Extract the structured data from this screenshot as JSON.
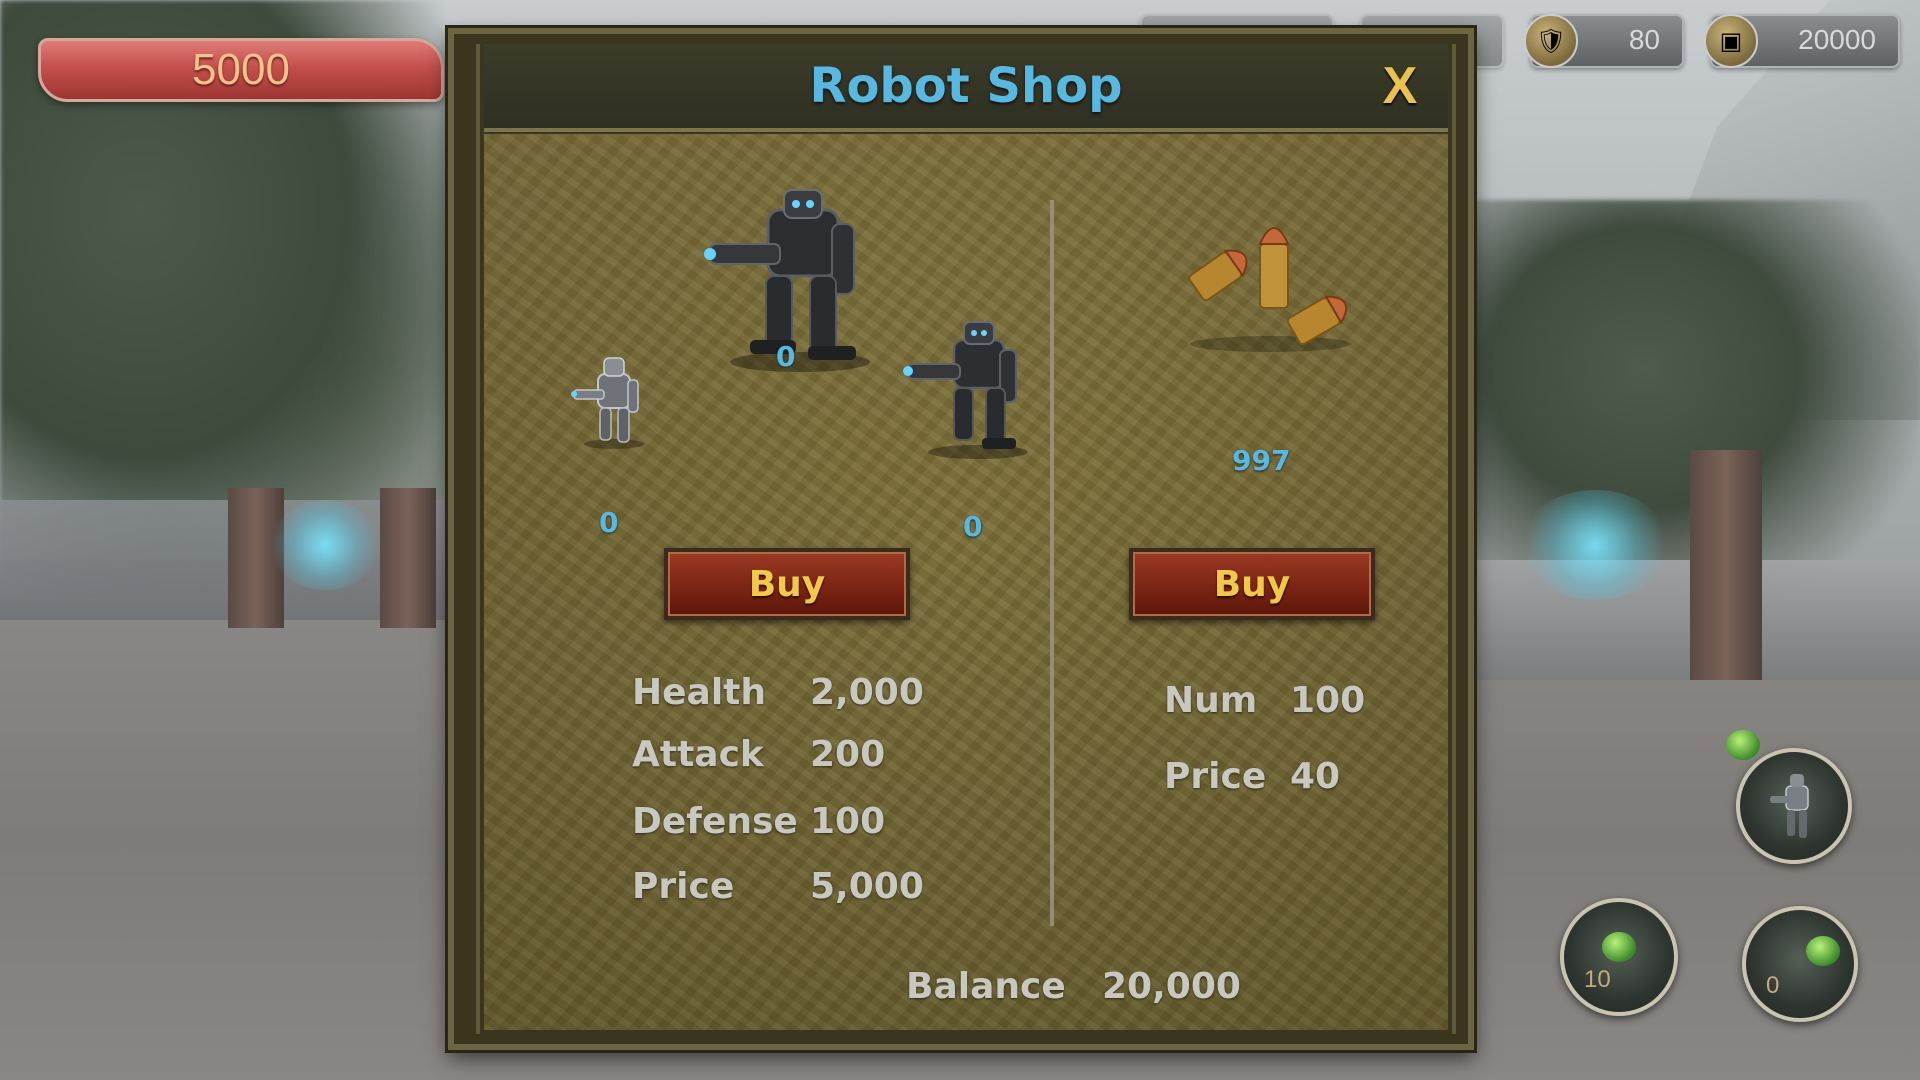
{
  "hud": {
    "health_value": "5000",
    "resources": [
      {
        "icon": "shield-resource-icon",
        "value": "80"
      },
      {
        "icon": "treasure-chest-icon",
        "value": "20000"
      }
    ]
  },
  "shop": {
    "title": "Robot Shop",
    "close_label": "X",
    "robots": {
      "counts": {
        "small": "0",
        "large": "0",
        "medium": "0"
      },
      "buy_label": "Buy",
      "stats": [
        {
          "label": "Health",
          "value": "2,000"
        },
        {
          "label": "Attack",
          "value": "200"
        },
        {
          "label": "Defense",
          "value": "100"
        },
        {
          "label": "Price",
          "value": "5,000"
        }
      ]
    },
    "ammo": {
      "count": "997",
      "buy_label": "Buy",
      "stats": [
        {
          "label": "Num",
          "value": "100"
        },
        {
          "label": "Price",
          "value": "40"
        }
      ]
    },
    "balance_label": "Balance",
    "balance_value": "20,000"
  },
  "skills": [
    {
      "name": "robot-summon-skill",
      "count": ""
    },
    {
      "name": "grenade-skill",
      "count": "10"
    },
    {
      "name": "potion-skill",
      "count": "0"
    }
  ],
  "colors": {
    "title": "#58b8e0",
    "button_text": "#f2c84b",
    "button_bg": "#7c2514",
    "stat_text": "#c9c8c0",
    "health_bar": "#c4504d"
  }
}
